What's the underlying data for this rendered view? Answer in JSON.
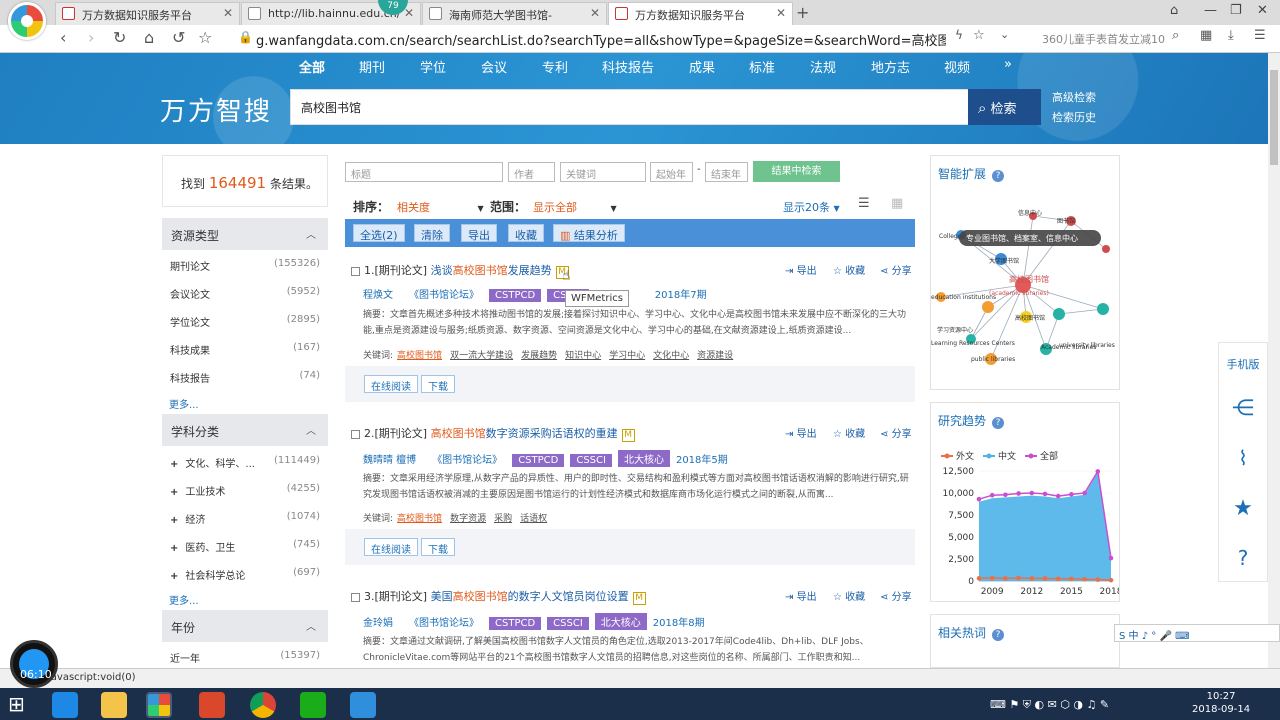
{
  "browser": {
    "tabs": [
      {
        "label": "万方数据知识服务平台",
        "active": false
      },
      {
        "label": "http://lib.hainnu.edu.cn/",
        "active": false
      },
      {
        "label": "海南师范大学图书馆-",
        "active": false
      },
      {
        "label": "万方数据知识服务平台",
        "active": true
      }
    ],
    "badge": "79",
    "url": "g.wanfangdata.com.cn/search/searchList.do?searchType=all&showType=&pageSize=&searchWord=高校图书馆&isTrig",
    "search_hint": "360儿童手表首发立减10"
  },
  "site": {
    "nav": [
      "全部",
      "期刊",
      "学位",
      "会议",
      "专利",
      "科技报告",
      "成果",
      "标准",
      "法规",
      "地方志",
      "视频",
      "»"
    ],
    "brand": "万方智搜",
    "search_value": "高校图书馆",
    "search_button": "检索",
    "adv_search": "高级检索",
    "history": "检索历史"
  },
  "count": {
    "prefix": "找到",
    "number": "164491",
    "suffix": "条结果。"
  },
  "sidebar": {
    "resource": {
      "title": "资源类型",
      "items": [
        {
          "label": "期刊论文",
          "count": "(155326)"
        },
        {
          "label": "会议论文",
          "count": "(5952)"
        },
        {
          "label": "学位论文",
          "count": "(2895)"
        },
        {
          "label": "科技成果",
          "count": "(167)"
        },
        {
          "label": "科技报告",
          "count": "(74)"
        }
      ],
      "more": "更多..."
    },
    "subject": {
      "title": "学科分类",
      "items": [
        {
          "label": "文化、科学、...",
          "count": "(111449)"
        },
        {
          "label": "工业技术",
          "count": "(4255)"
        },
        {
          "label": "经济",
          "count": "(1074)"
        },
        {
          "label": "医药、卫生",
          "count": "(745)"
        },
        {
          "label": "社会科学总论",
          "count": "(697)"
        }
      ],
      "more": "更多..."
    },
    "year": {
      "title": "年份",
      "items": [
        {
          "label": "近一年",
          "count": "(15397)"
        }
      ]
    }
  },
  "filters": {
    "title": "标题",
    "author": "作者",
    "keyword": "关键词",
    "start": "起始年",
    "end": "结束年",
    "button": "结果中检索"
  },
  "sort": {
    "label": "排序：",
    "value": "相关度",
    "range_label": "范围：",
    "range_value": "显示全部",
    "pagesize": "显示20条"
  },
  "actions": [
    "全选(2)",
    "清除",
    "导出",
    "收藏",
    "结果分析"
  ],
  "results": [
    {
      "prefix": "1.[期刊论文] ",
      "t1": "浅谈",
      "hl": "高校图书馆",
      "t2": "发展趋势",
      "authors": "程焕文",
      "journal": "《图书馆论坛》",
      "tags": [
        "CSTPCD",
        "CSSCI"
      ],
      "date": "2018年7期",
      "abstract": "摘要：文章首先概述多种技术将推动图书馆的发展;接着探讨知识中心、学习中心、文化中心是高校图书馆未来发展中应不断深化的三大功能,重点是资源建设与服务;纸质资源、数字资源、空间资源是文化中心、学习中心的基础,在文献资源建设上,纸质资源建设...",
      "kw_label": "关键词:",
      "keywords": [
        "高校图书馆",
        "双一流大学建设",
        "发展趋势",
        "知识中心",
        "学习中心",
        "文化中心",
        "资源建设"
      ]
    },
    {
      "prefix": "2.[期刊论文] ",
      "t1": "",
      "hl": "高校图书馆",
      "t2": "数字资源采购话语权的重建",
      "authors": "魏晴晴  檀博",
      "journal": "《图书馆论坛》",
      "tags": [
        "CSTPCD",
        "CSSCI",
        "北大核心"
      ],
      "date": "2018年5期",
      "abstract": "摘要：文章采用经济学原理,从数字产品的异质性、用户的即时性、交易结构和盈利模式等方面对高校图书馆话语权消解的影响进行研究,研究发现图书馆话语权被消减的主要原因是图书馆运行的计划性经济模式和数据库商市场化运行模式之间的断裂,从而寓...",
      "kw_label": "关键词:",
      "keywords": [
        "高校图书馆",
        "数字资源",
        "采购",
        "话语权"
      ]
    },
    {
      "prefix": "3.[期刊论文] ",
      "t1": "美国",
      "hl": "高校图书馆",
      "t2": "的数字人文馆员岗位设置",
      "authors": "金玲娟",
      "journal": "《图书馆论坛》",
      "tags": [
        "CSTPCD",
        "CSSCI",
        "北大核心"
      ],
      "date": "2018年8期",
      "abstract": "摘要：文章通过文献调研,了解美国高校图书馆数字人文馆员的角色定位,选取2013-2017年间Code4lib、Dh+lib、DLF Jobs、ChronicleVitae.com等网站平台的21个高校图书馆数字人文馆员的招聘信息,对这些岗位的名称、所属部门、工作职责和知..."
    }
  ],
  "result_actions": {
    "export": "导出",
    "fav": "收藏",
    "share": "分享",
    "read": "在线阅读",
    "download": "下载",
    "m": "M"
  },
  "tooltip": "WFMetrics",
  "panels": {
    "smart": {
      "title": "智能扩展",
      "tip": "专业图书馆、档案室、信息中心",
      "nodes": [
        "高校图书馆",
        "(academic libraries)",
        "Colleges",
        "大学图书馆",
        "Academic libraries",
        "university libraries",
        "public libraries",
        "Learning Resources Centers",
        "信息中心",
        "图书馆",
        "高校图书馆",
        "education institutions",
        "学习资源中心"
      ]
    },
    "trend": {
      "title": "研究趋势",
      "legend": [
        "外文",
        "中文",
        "全部"
      ]
    },
    "hot": {
      "title": "相关热词"
    }
  },
  "chart_data": {
    "type": "area",
    "title": "研究趋势",
    "series": [
      {
        "name": "外文",
        "color": "#e8714a",
        "values": [
          300,
          350,
          300,
          350,
          300,
          300,
          250,
          250,
          200,
          150,
          100
        ]
      },
      {
        "name": "中文",
        "color": "#4db3e8",
        "values": [
          9000,
          9400,
          9500,
          9600,
          9700,
          9600,
          9400,
          9600,
          9800,
          12300,
          2500
        ]
      },
      {
        "name": "全部",
        "color": "#c84fd0",
        "values": [
          9300,
          9750,
          9800,
          9950,
          10000,
          9900,
          9650,
          9850,
          10000,
          12450,
          2600
        ]
      }
    ],
    "x": [
      2008,
      2009,
      2010,
      2011,
      2012,
      2013,
      2014,
      2015,
      2016,
      2017,
      2018
    ],
    "xticks": [
      "2009",
      "2012",
      "2015",
      "2018"
    ],
    "yticks": [
      "0",
      "2,500",
      "5,000",
      "7,500",
      "10,000",
      "12,500"
    ],
    "ylim": [
      0,
      12500
    ]
  },
  "float": {
    "mobile": "手机版"
  },
  "status": {
    "left": "javascript:void(0)",
    "clock": "06:10",
    "time": "10:27",
    "date": "2018-09-14"
  },
  "ime": "S 中 ♪ ° 🎤 ⌨"
}
